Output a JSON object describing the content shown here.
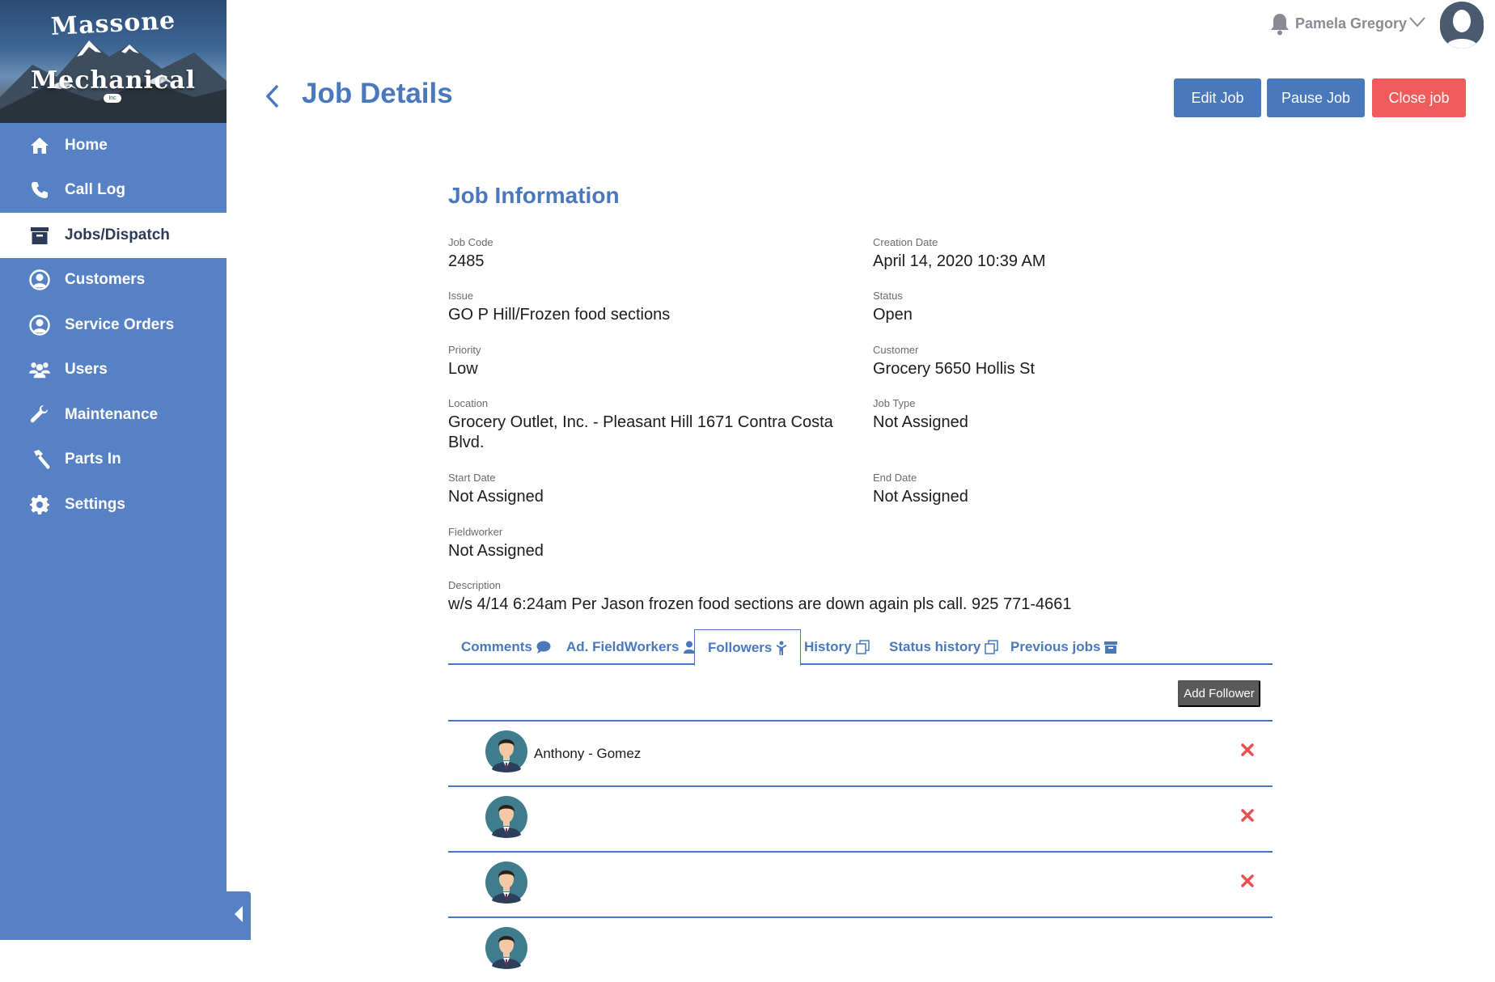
{
  "app": {
    "logo_line1": "Massone",
    "logo_line2": "Mechanical",
    "logo_line3": "Inc"
  },
  "sidebar": {
    "items": [
      {
        "label": "Home",
        "icon": "home-icon"
      },
      {
        "label": "Call Log",
        "icon": "phone-icon"
      },
      {
        "label": "Jobs/Dispatch",
        "icon": "archive-box-icon",
        "active": true
      },
      {
        "label": "Customers",
        "icon": "user-circle-icon"
      },
      {
        "label": "Service Orders",
        "icon": "user-circle-icon"
      },
      {
        "label": "Users",
        "icon": "users-icon"
      },
      {
        "label": "Maintenance",
        "icon": "wrench-icon"
      },
      {
        "label": "Parts In",
        "icon": "hammer-icon"
      },
      {
        "label": "Settings",
        "icon": "gear-icon"
      }
    ]
  },
  "header": {
    "user_name": "Pamela Gregory"
  },
  "page": {
    "title": "Job Details",
    "edit_label": "Edit Job",
    "pause_label": "Pause Job",
    "close_label": "Close job"
  },
  "job": {
    "section_title": "Job Information",
    "fields": {
      "job_code": {
        "label": "Job Code",
        "value": "2485"
      },
      "creation_date": {
        "label": "Creation Date",
        "value": "April 14, 2020 10:39 AM"
      },
      "issue": {
        "label": "Issue",
        "value": "GO P Hill/Frozen food sections"
      },
      "status": {
        "label": "Status",
        "value": "Open"
      },
      "priority": {
        "label": "Priority",
        "value": "Low"
      },
      "customer": {
        "label": "Customer",
        "value": "Grocery 5650 Hollis St"
      },
      "location": {
        "label": "Location",
        "value": "Grocery Outlet, Inc. - Pleasant Hill 1671 Contra Costa Blvd."
      },
      "job_type": {
        "label": "Job Type",
        "value": "Not Assigned"
      },
      "start_date": {
        "label": "Start Date",
        "value": "Not Assigned"
      },
      "end_date": {
        "label": "End Date",
        "value": "Not Assigned"
      },
      "fieldworker": {
        "label": "Fieldworker",
        "value": "Not Assigned"
      },
      "description": {
        "label": "Description",
        "value": "w/s 4/14 6:24am Per Jason frozen food sections are down again pls call. 925 771-4661"
      }
    }
  },
  "tabs": [
    {
      "label": "Comments",
      "icon": "comment-icon"
    },
    {
      "label": "Ad. FieldWorkers",
      "icon": "user-icon"
    },
    {
      "label": "Followers",
      "icon": "follower-icon",
      "active": true
    },
    {
      "label": "History",
      "icon": "copy-icon"
    },
    {
      "label": "Status history",
      "icon": "copy-icon"
    },
    {
      "label": "Previous jobs",
      "icon": "archive-box-icon"
    }
  ],
  "followers": {
    "add_label": "Add Follower",
    "items": [
      {
        "name": "Anthony - Gomez"
      },
      {
        "name": ""
      },
      {
        "name": ""
      },
      {
        "name": ""
      }
    ]
  },
  "colors": {
    "primary": "#4a78bd",
    "sidebar": "#5681c4",
    "danger": "#f15b5b",
    "dark_button": "#5a5a5a"
  }
}
